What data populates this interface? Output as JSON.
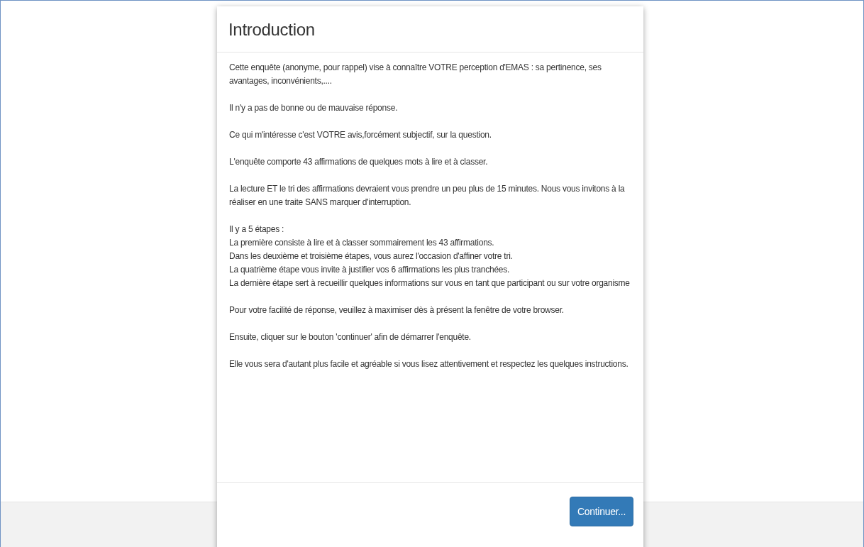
{
  "modal": {
    "title": "Introduction",
    "paragraphs": [
      {
        "lines": [
          "Cette enquête (anonyme, pour rappel) vise à connaître VOTRE perception d'EMAS : sa pertinence, ses avantages, inconvénients,...."
        ]
      },
      {
        "lines": [
          "Il n'y a pas de bonne ou de mauvaise réponse."
        ]
      },
      {
        "lines": [
          "Ce qui m'intéresse c'est VOTRE avis,forcément subjectif, sur la question."
        ]
      },
      {
        "lines": [
          "L'enquête comporte 43 affirmations de quelques mots à lire et à classer."
        ]
      },
      {
        "lines": [
          "La lecture ET le tri des affirmations devraient vous prendre un peu plus de 15 minutes. Nous vous invitons à la réaliser en une traite SANS marquer d'interruption."
        ]
      },
      {
        "lines": [
          "Il y a 5 étapes :",
          "La première consiste à lire et à classer sommairement les 43 affirmations.",
          "Dans les deuxième et troisième étapes, vous aurez l'occasion d'affiner votre tri.",
          "La quatrième étape vous invite à justifier vos 6 affirmations les plus tranchées.",
          "La dernière étape sert à recueillir quelques informations sur vous en tant que participant ou sur votre organisme"
        ]
      },
      {
        "lines": [
          "Pour votre facilité de réponse, veuillez à maximiser dès à présent la fenêtre de votre browser."
        ]
      },
      {
        "lines": [
          "Ensuite, cliquer sur le bouton 'continuer' afin de démarrer l'enquête."
        ]
      },
      {
        "lines": [
          "Elle vous sera d'autant plus facile et agréable si vous lisez attentivement et respectez les quelques instructions."
        ]
      }
    ],
    "button": "Continuer..."
  }
}
